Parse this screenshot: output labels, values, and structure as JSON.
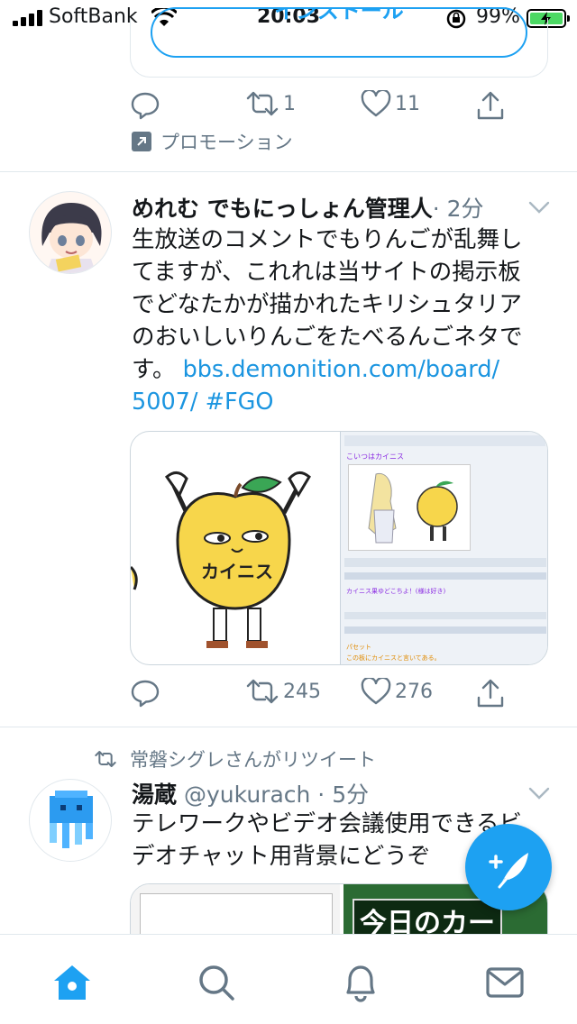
{
  "status_bar": {
    "carrier": "SoftBank",
    "time": "20:03",
    "battery": "99%",
    "battery_level": 0.99
  },
  "promo_tweet": {
    "install_label": "インストール",
    "retweets": "1",
    "likes": "11",
    "promotion_label": "プロモーション"
  },
  "tweet1": {
    "name": "めれむ でもにっしょん管理人",
    "time": "· 2分",
    "text_lines": [
      "生放送のコメントでもりんごが乱舞し",
      "てますが、これれは当サイトの掲示板",
      "でどなたかが描かれたキリシュタリア",
      "のおいしいりんごをたべるんごネタで",
      "す。"
    ],
    "link_part1": "bbs.demonition.com/board/",
    "link_part2": "5007/",
    "hashtag": "#FGO",
    "media_left_text": "カイニス",
    "media_right_lines": [
      "こいつはカイニス",
      "カイニス果ゆどこちよ！(様は好き)",
      "パセット",
      "この板にカイニスと言いてある。"
    ],
    "retweets": "245",
    "likes": "276"
  },
  "retweet_label": "常磐シグレさんがリツイート",
  "tweet2": {
    "name": "湯蔵",
    "handle_time": "@yukurach · 5分",
    "text_lines": [
      "テレワークやビデオ会議使用できるビ",
      "デオチャット用背景にどうぞ"
    ],
    "media_right_text": "今日のカー"
  },
  "tabbar": {
    "items": [
      "home-icon",
      "search-icon",
      "notifications-icon",
      "messages-icon"
    ]
  },
  "colors": {
    "accent": "#1da1f2",
    "link": "#1b95e0",
    "secondary_text": "#657786",
    "divider": "#e1e8ed"
  }
}
